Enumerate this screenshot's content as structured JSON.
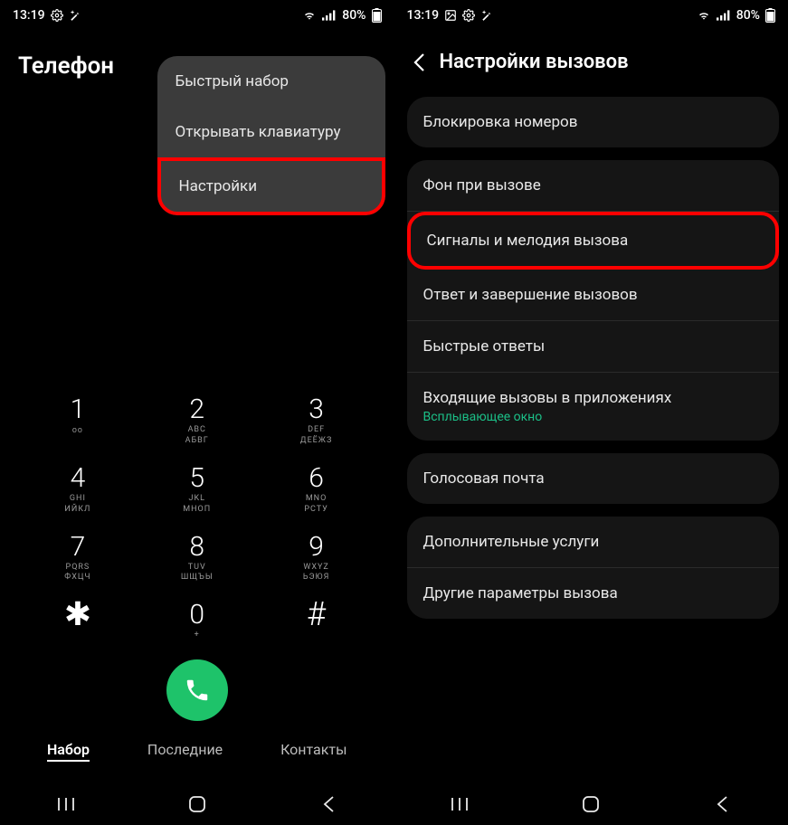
{
  "status": {
    "time": "13:19",
    "battery": "80%"
  },
  "left": {
    "title": "Телефон",
    "menu": [
      "Быстрый набор",
      "Открывать клавиатуру",
      "Настройки"
    ],
    "pad": [
      {
        "n": "1",
        "s": "",
        "r": "ᴏᴏ"
      },
      {
        "n": "2",
        "s": "ABC",
        "r": "АБВГ"
      },
      {
        "n": "3",
        "s": "DEF",
        "r": "ДЕЁЖЗ"
      },
      {
        "n": "4",
        "s": "GHI",
        "r": "ИЙКЛ"
      },
      {
        "n": "5",
        "s": "JKL",
        "r": "МНОП"
      },
      {
        "n": "6",
        "s": "MNO",
        "r": "РСТУ"
      },
      {
        "n": "7",
        "s": "PQRS",
        "r": "ФХЦЧ"
      },
      {
        "n": "8",
        "s": "TUV",
        "r": "ШЩЪЫ"
      },
      {
        "n": "9",
        "s": "WXYZ",
        "r": "ЬЭЮЯ"
      },
      {
        "n": "✱",
        "s": "",
        "r": ""
      },
      {
        "n": "0",
        "s": "+",
        "r": ""
      },
      {
        "n": "#",
        "s": "",
        "r": ""
      }
    ],
    "tabs": [
      "Набор",
      "Последние",
      "Контакты"
    ]
  },
  "right": {
    "title": "Настройки вызовов",
    "groups": [
      [
        {
          "t": "Блокировка номеров"
        }
      ],
      [
        {
          "t": "Фон при вызове"
        },
        {
          "t": "Сигналы и мелодия вызова",
          "hl": true
        },
        {
          "t": "Ответ и завершение вызовов"
        },
        {
          "t": "Быстрые ответы"
        },
        {
          "t": "Входящие вызовы в приложениях",
          "sub": "Всплывающее окно"
        }
      ],
      [
        {
          "t": "Голосовая почта"
        }
      ],
      [
        {
          "t": "Дополнительные услуги"
        },
        {
          "t": "Другие параметры вызова"
        }
      ]
    ]
  }
}
